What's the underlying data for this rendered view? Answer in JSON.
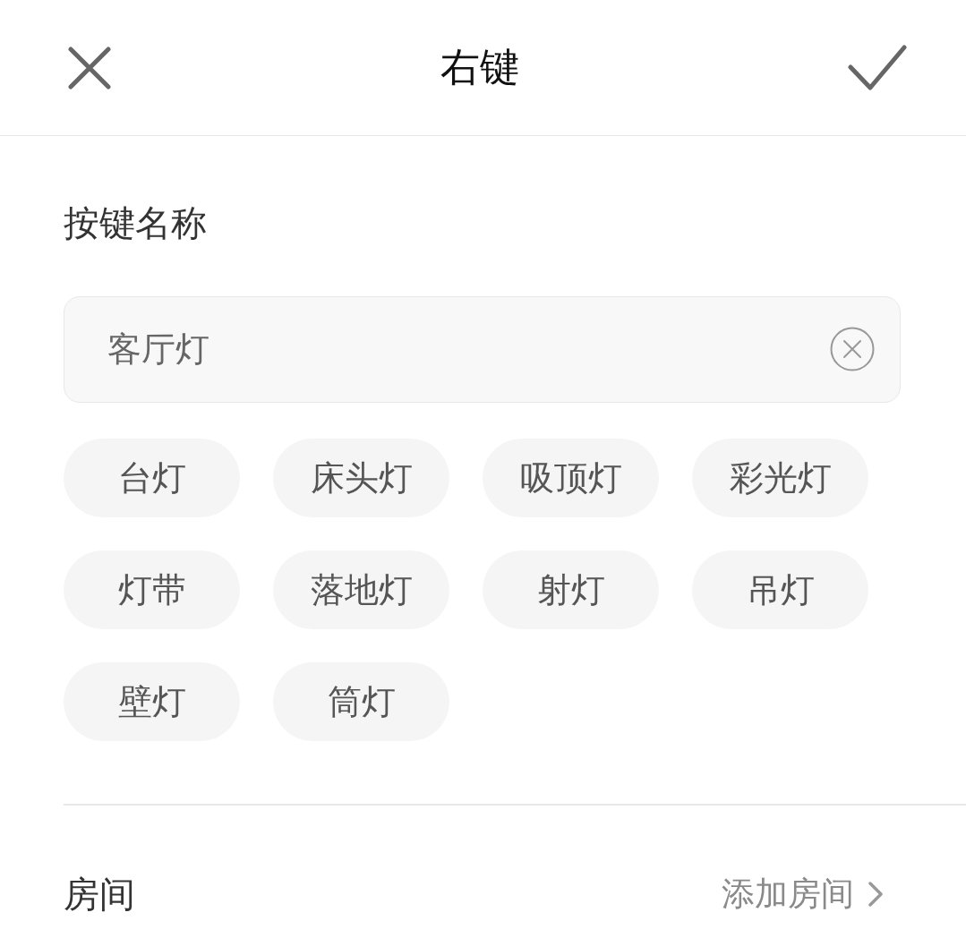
{
  "header": {
    "title": "右键"
  },
  "name_section": {
    "label": "按键名称",
    "input": {
      "value": "客厅灯"
    },
    "suggestions": [
      "台灯",
      "床头灯",
      "吸顶灯",
      "彩光灯",
      "灯带",
      "落地灯",
      "射灯",
      "吊灯",
      "壁灯",
      "筒灯"
    ]
  },
  "room": {
    "label": "房间",
    "action": "添加房间"
  }
}
